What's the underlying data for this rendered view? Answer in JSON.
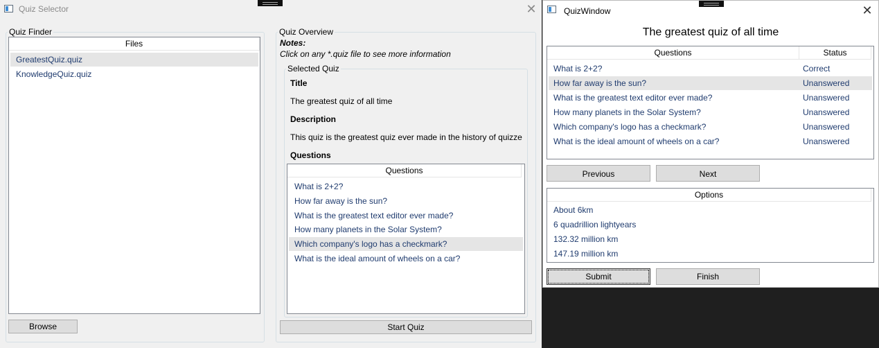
{
  "selector": {
    "title": "Quiz Selector",
    "close_glyph": "✕",
    "finder": {
      "legend": "Quiz Finder",
      "column": "Files",
      "files": [
        "GreatestQuiz.quiz",
        "KnowledgeQuiz.quiz"
      ],
      "selected_index": 0,
      "browse_label": "Browse"
    },
    "overview": {
      "legend": "Quiz Overview",
      "notes_label": "Notes:",
      "notes_text": "Click on any *.quiz file to see more information",
      "selected_legend": "Selected Quiz",
      "title_label": "Title",
      "title_value": "The greatest quiz of all time",
      "description_label": "Description",
      "description_value": "This quiz is the greatest quiz ever made in the history of quizzes",
      "questions_label": "Questions",
      "questions_column": "Questions",
      "questions": [
        "What is 2+2?",
        "How far away is the sun?",
        "What is the greatest text editor ever made?",
        "How many planets in the Solar System?",
        "Which company's logo has a checkmark?",
        "What is the ideal amount of wheels on a car?"
      ],
      "selected_question_index": 4,
      "start_label": "Start Quiz"
    }
  },
  "quizwindow": {
    "title": "QuizWindow",
    "close_glyph": "✕",
    "heading": "The greatest quiz of all time",
    "columns": {
      "question": "Questions",
      "status": "Status"
    },
    "rows": [
      {
        "question": "What is 2+2?",
        "status": "Correct"
      },
      {
        "question": "How far away is the sun?",
        "status": "Unanswered"
      },
      {
        "question": "What is the greatest text editor ever made?",
        "status": "Unanswered"
      },
      {
        "question": "How many planets in the Solar System?",
        "status": "Unanswered"
      },
      {
        "question": "Which company's logo has a checkmark?",
        "status": "Unanswered"
      },
      {
        "question": "What is the ideal amount of wheels on a car?",
        "status": "Unanswered"
      }
    ],
    "selected_row_index": 1,
    "previous_label": "Previous",
    "next_label": "Next",
    "options_column": "Options",
    "options": [
      "About 6km",
      "6 quadrillion lightyears",
      "132.32 million km",
      "147.19 million km"
    ],
    "submit_label": "Submit",
    "finish_label": "Finish"
  }
}
